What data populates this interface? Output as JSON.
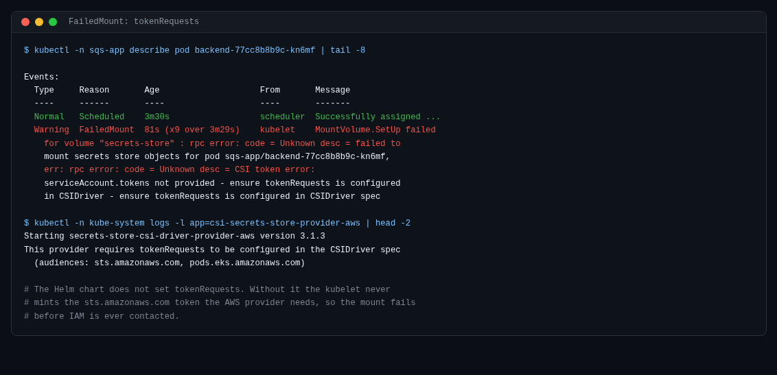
{
  "window": {
    "title": "FailedMount: tokenRequests"
  },
  "blocks": [
    [
      {
        "kind": "command",
        "text": "$ kubectl -n sqs-app describe pod backend-77cc8b8b9c-kn6mf | tail -8"
      }
    ],
    [
      {
        "kind": "output",
        "text": "Events:"
      },
      {
        "kind": "output",
        "text": "  Type     Reason       Age                    From       Message"
      },
      {
        "kind": "output",
        "text": "  ----     ------       ----                   ----       -------"
      },
      {
        "kind": "success",
        "text": "  Normal   Scheduled    3m30s                  scheduler  Successfully assigned ..."
      },
      {
        "kind": "error",
        "text": "  Warning  FailedMount  81s (x9 over 3m29s)    kubelet    MountVolume.SetUp failed"
      },
      {
        "kind": "error",
        "text": "    for volume \"secrets-store\" : rpc error: code = Unknown desc = failed to"
      },
      {
        "kind": "output",
        "text": "    mount secrets store objects for pod sqs-app/backend-77cc8b8b9c-kn6mf,"
      },
      {
        "kind": "error",
        "text": "    err: rpc error: code = Unknown desc = CSI token error:"
      },
      {
        "kind": "output",
        "text": "    serviceAccount.tokens not provided - ensure tokenRequests is configured"
      },
      {
        "kind": "output",
        "text": "    in CSIDriver - ensure tokenRequests is configured in CSIDriver spec"
      }
    ],
    [
      {
        "kind": "command",
        "text": "$ kubectl -n kube-system logs -l app=csi-secrets-store-provider-aws | head -2"
      },
      {
        "kind": "output",
        "text": "Starting secrets-store-csi-driver-provider-aws version 3.1.3"
      },
      {
        "kind": "output",
        "text": "This provider requires tokenRequests to be configured in the CSIDriver spec"
      },
      {
        "kind": "output",
        "text": "  (audiences: sts.amazonaws.com, pods.eks.amazonaws.com)"
      }
    ],
    [
      {
        "kind": "comment",
        "text": "# The Helm chart does not set tokenRequests. Without it the kubelet never"
      },
      {
        "kind": "comment",
        "text": "# mints the sts.amazonaws.com token the AWS provider needs, so the mount fails"
      },
      {
        "kind": "comment",
        "text": "# before IAM is ever contacted."
      }
    ]
  ]
}
